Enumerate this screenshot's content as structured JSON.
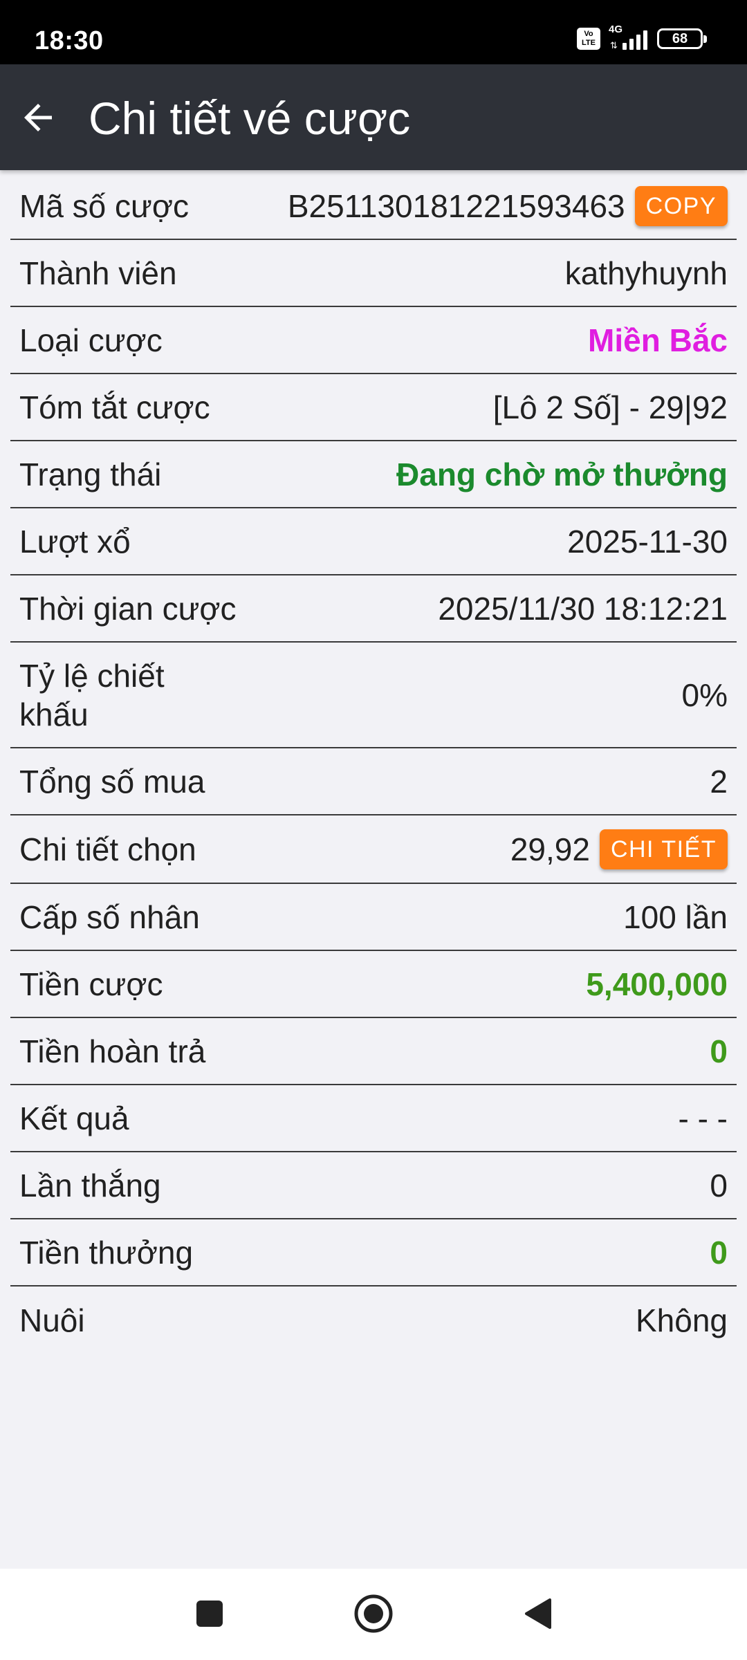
{
  "status_bar": {
    "time": "18:30",
    "volte_label": "Vo LTE",
    "network": "4G",
    "battery": "68"
  },
  "app_bar": {
    "title": "Chi tiết vé cược",
    "back_icon": "arrow-left-icon"
  },
  "details": {
    "bet_code": {
      "label": "Mã số cược",
      "value": "B251130181221593463",
      "action": "COPY"
    },
    "member": {
      "label": "Thành viên",
      "value": "kathyhuynh"
    },
    "bet_type": {
      "label": "Loại cược",
      "value": "Miền Bắc"
    },
    "summary": {
      "label": "Tóm tắt cược",
      "value": "[Lô 2 Số] - 29|92"
    },
    "status": {
      "label": "Trạng thái",
      "value": "Đang chờ mở thưởng"
    },
    "draw": {
      "label": "Lượt xổ",
      "value": "2025-11-30"
    },
    "bet_time": {
      "label": "Thời gian cược",
      "value": "2025/11/30 18:12:21"
    },
    "discount": {
      "label": "Tỷ lệ chiết khấu",
      "value": "0%"
    },
    "total_buy": {
      "label": "Tổng số mua",
      "value": "2"
    },
    "selection": {
      "label": "Chi tiết chọn",
      "value": "29,92",
      "action": "CHI TIẾT"
    },
    "multiplier": {
      "label": "Cấp số nhân",
      "value": "100 lần"
    },
    "stake": {
      "label": "Tiền cược",
      "value": "5,400,000"
    },
    "refund": {
      "label": "Tiền hoàn trả",
      "value": "0"
    },
    "result": {
      "label": "Kết quả",
      "value": "- - -"
    },
    "wins": {
      "label": "Lần thắng",
      "value": "0"
    },
    "prize": {
      "label": "Tiền thưởng",
      "value": "0"
    },
    "nurture": {
      "label": "Nuôi",
      "value": "Không"
    }
  },
  "colors": {
    "app_bar": "#2e3138",
    "background": "#f2f2f6",
    "accent_button": "#ff7d14",
    "pink": "#e01ee0",
    "status_green": "#1b8a2d",
    "money_green": "#3f9a1b"
  },
  "nav_bar": {
    "recent_icon": "square-icon",
    "home_icon": "circle-home-icon",
    "back_icon": "triangle-back-icon"
  }
}
